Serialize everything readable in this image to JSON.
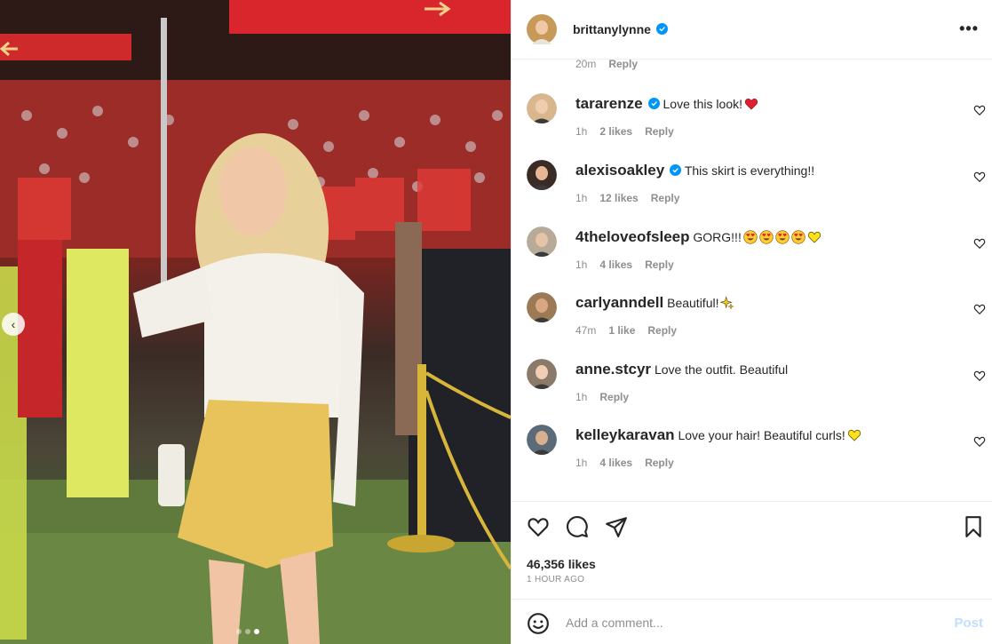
{
  "post": {
    "author": "brittanylynne",
    "verified": true,
    "likes": "46,356 likes",
    "time_ago": "1 HOUR AGO",
    "slides": {
      "count": 3,
      "active": 3
    }
  },
  "previous_comment_meta": {
    "time": "20m",
    "reply": "Reply"
  },
  "comments": [
    {
      "user": "tararenze",
      "verified": true,
      "text": "Love this look!",
      "emoji": [
        "red-heart"
      ],
      "time": "1h",
      "likes": "2 likes",
      "reply": "Reply"
    },
    {
      "user": "alexisoakley",
      "verified": true,
      "text": "This skirt is everything!!",
      "emoji": [],
      "time": "1h",
      "likes": "12 likes",
      "reply": "Reply"
    },
    {
      "user": "4theloveofsleep",
      "verified": false,
      "text": "GORG!!!",
      "emoji": [
        "heart-eyes",
        "heart-eyes",
        "heart-eyes",
        "heart-eyes",
        "yellow-heart"
      ],
      "time": "1h",
      "likes": "4 likes",
      "reply": "Reply"
    },
    {
      "user": "carlyanndell",
      "verified": false,
      "text": "Beautiful!",
      "emoji": [
        "sparkles"
      ],
      "time": "47m",
      "likes": "1 like",
      "reply": "Reply"
    },
    {
      "user": "anne.stcyr",
      "verified": false,
      "text": "Love the outfit. Beautiful",
      "emoji": [],
      "time": "1h",
      "likes": "",
      "reply": "Reply"
    },
    {
      "user": "kelleykaravan",
      "verified": false,
      "text": "Love your hair! Beautiful curls!",
      "emoji": [
        "yellow-heart"
      ],
      "time": "1h",
      "likes": "4 likes",
      "reply": "Reply"
    }
  ],
  "comment_box": {
    "placeholder": "Add a comment...",
    "post_label": "Post"
  },
  "icons": {
    "more": "more-horizontal-icon",
    "like": "heart-outline-icon",
    "comment": "comment-bubble-icon",
    "share": "paper-plane-icon",
    "save": "bookmark-icon",
    "emoji": "smiley-icon",
    "prev": "chevron-left-icon"
  },
  "colors": {
    "verified": "#0095f6",
    "post_disabled": "#c0dffd",
    "meta": "#8e8e8e",
    "text": "#262626"
  }
}
